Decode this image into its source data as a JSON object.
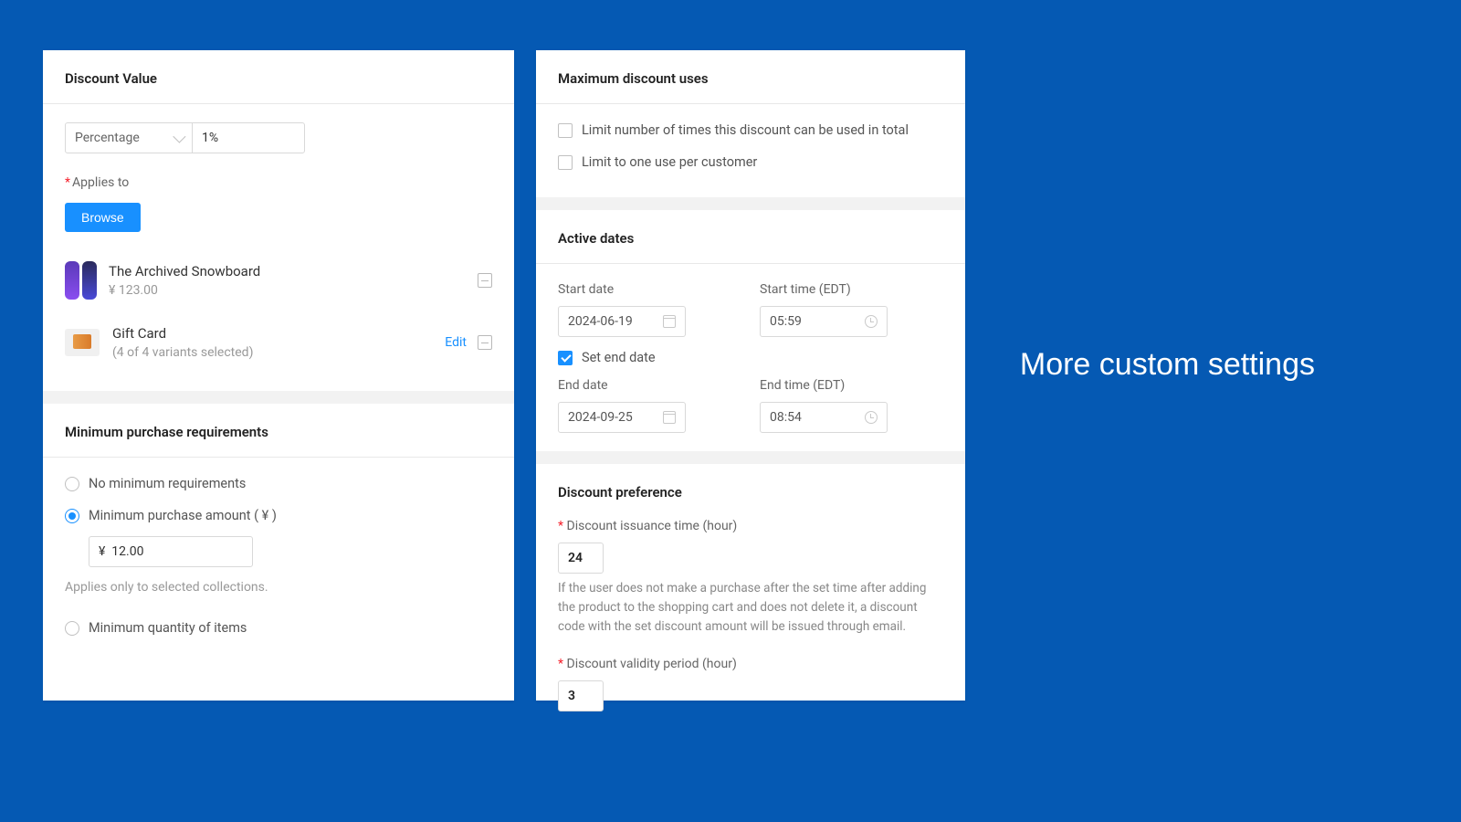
{
  "callout": "More custom settings",
  "discountValue": {
    "title": "Discount Value",
    "typeSelected": "Percentage",
    "value": "1%",
    "appliesToLabel": "Applies to",
    "browse": "Browse",
    "products": [
      {
        "name": "The Archived Snowboard",
        "sub": "¥ 123.00"
      },
      {
        "name": "Gift Card",
        "sub": "(4 of 4 variants selected)"
      }
    ],
    "editLabel": "Edit"
  },
  "minReq": {
    "title": "Minimum purchase requirements",
    "optNone": "No minimum requirements",
    "optAmount": "Minimum purchase amount ( ¥ )",
    "amountValue": "¥  12.00",
    "helper": "Applies only to selected collections.",
    "optQty": "Minimum quantity of items"
  },
  "maxUses": {
    "title": "Maximum discount uses",
    "limitTotal": "Limit number of times this discount can be used in total",
    "limitPerCust": "Limit to one use per customer"
  },
  "activeDates": {
    "title": "Active dates",
    "startDateLabel": "Start date",
    "startTimeLabel": "Start time (EDT)",
    "startDate": "2024-06-19",
    "startTime": "05:59",
    "setEndLabel": "Set end date",
    "endDateLabel": "End date",
    "endTimeLabel": "End time (EDT)",
    "endDate": "2024-09-25",
    "endTime": "08:54"
  },
  "pref": {
    "title": "Discount preference",
    "issuanceLabel": "Discount issuance time (hour)",
    "issuanceValue": "24",
    "issuanceHelp": "If the user does not make a purchase after the set time after adding the product to the shopping cart and does not delete it, a discount code with the set discount amount will be issued through email.",
    "validityLabel": "Discount validity period (hour)",
    "validityValue": "3"
  }
}
